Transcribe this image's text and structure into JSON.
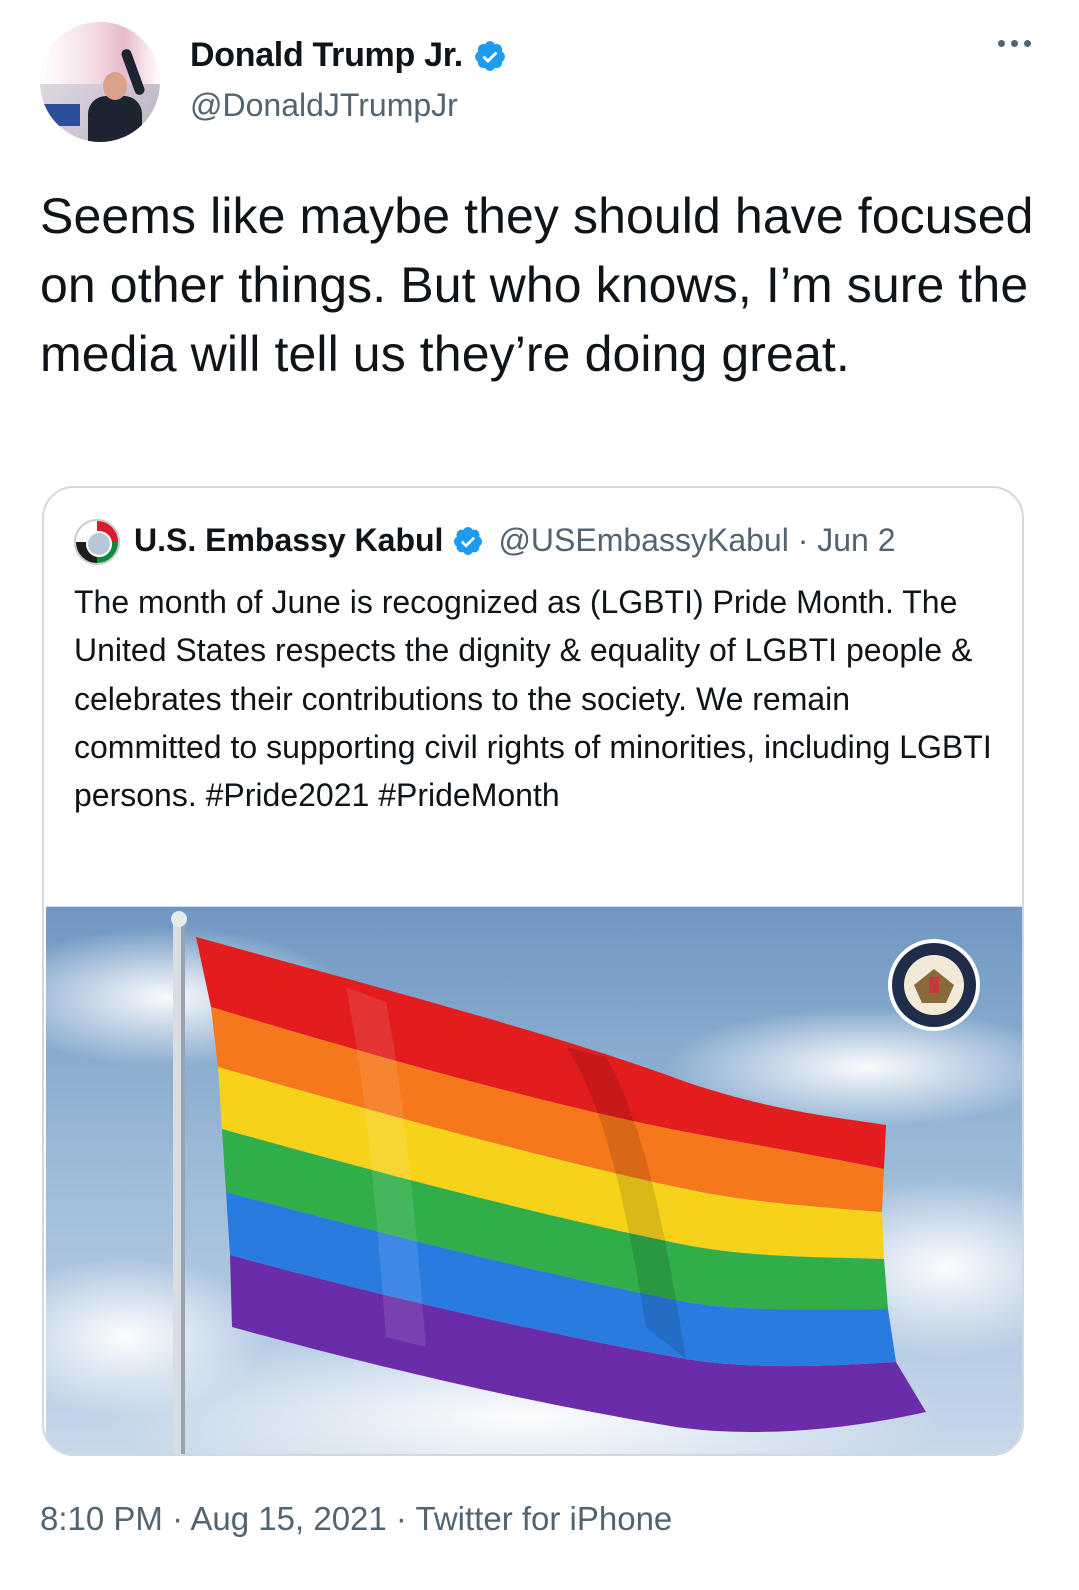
{
  "tweet": {
    "display_name": "Donald Trump Jr.",
    "handle": "@DonaldJTrumpJr",
    "verified_icon": "verified-badge-icon",
    "more_icon": "more-options-icon",
    "text": "Seems like maybe they should have focused on other things. But who knows, I’m sure the media will tell us they’re doing great.",
    "time": "8:10 PM",
    "date": "Aug 15, 2021",
    "source": "Twitter for iPhone",
    "separator": " · "
  },
  "quoted_tweet": {
    "display_name": "U.S. Embassy Kabul",
    "handle": "@USEmbassyKabul",
    "date": "Jun 2",
    "meta_separator": " · ",
    "text": "The month of June is recognized as (LGBTI) Pride Month. The United States respects the dignity & equality of LGBTI people & celebrates their contributions to the society. We remain committed to supporting civil rights of minorities, including LGBTI persons. #Pride2021 #PrideMonth",
    "image_icon": "rainbow-flag-image"
  },
  "colors": {
    "verified": "#1d9bf0",
    "secondary_text": "#536471",
    "border": "#cfd9de",
    "flag": [
      "#e31d1d",
      "#f5781a",
      "#f7d21b",
      "#2fae4a",
      "#2a7be0",
      "#6a2ca8"
    ]
  }
}
